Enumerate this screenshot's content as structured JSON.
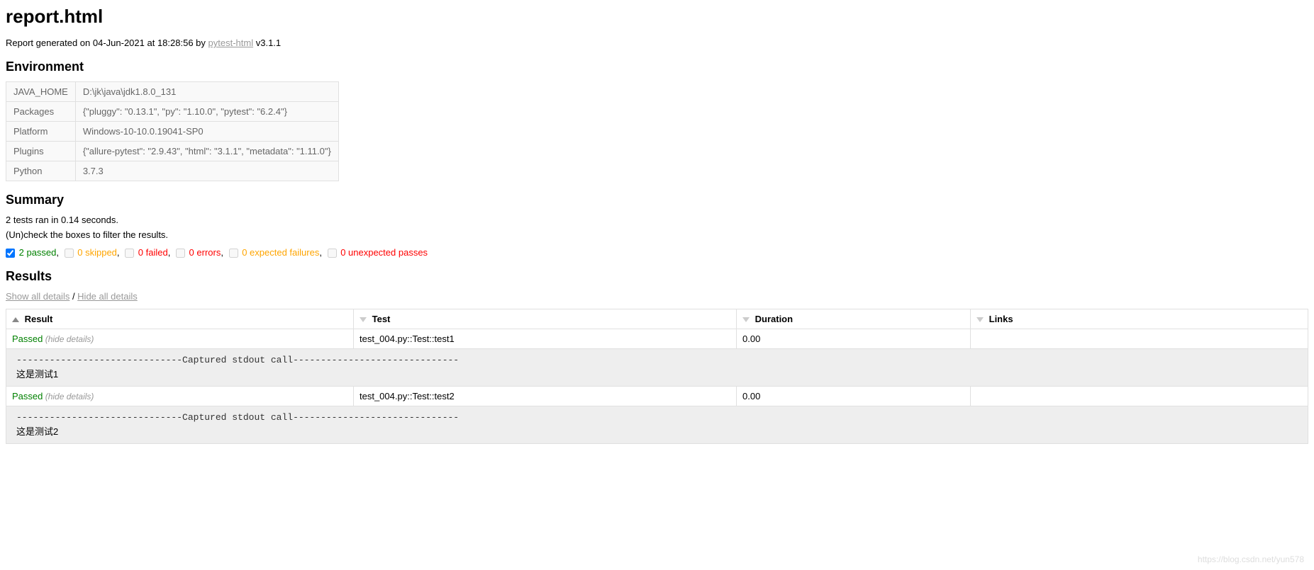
{
  "title": "report.html",
  "generated": {
    "prefix": "Report generated on ",
    "date": "04-Jun-2021",
    "at": " at ",
    "time": "18:28:56",
    "by": " by ",
    "tool_link": "pytest-html",
    "version": " v3.1.1"
  },
  "sections": {
    "environment": "Environment",
    "summary": "Summary",
    "results": "Results"
  },
  "environment": [
    {
      "key": "JAVA_HOME",
      "value": "D:\\jk\\java\\jdk1.8.0_131"
    },
    {
      "key": "Packages",
      "value": "{\"pluggy\": \"0.13.1\", \"py\": \"1.10.0\", \"pytest\": \"6.2.4\"}"
    },
    {
      "key": "Platform",
      "value": "Windows-10-10.0.19041-SP0"
    },
    {
      "key": "Plugins",
      "value": "{\"allure-pytest\": \"2.9.43\", \"html\": \"3.1.1\", \"metadata\": \"1.11.0\"}"
    },
    {
      "key": "Python",
      "value": "3.7.3"
    }
  ],
  "summary": {
    "ran": "2 tests ran in 0.14 seconds.",
    "uncheck": "(Un)check the boxes to filter the results."
  },
  "filters": {
    "passed": "2 passed",
    "skipped": "0 skipped",
    "failed": "0 failed",
    "errors": "0 errors",
    "expected": "0 expected failures",
    "unexpected": "0 unexpected passes"
  },
  "detail_links": {
    "show": "Show all details",
    "sep": " / ",
    "hide": "Hide all details"
  },
  "columns": {
    "result": "Result",
    "test": "Test",
    "duration": "Duration",
    "links": "Links"
  },
  "hide_details": "(hide details)",
  "stdout_header": "------------------------------Captured stdout call------------------------------",
  "tests": [
    {
      "result": "Passed",
      "test": "test_004.py::Test::test1",
      "duration": "0.00",
      "stdout": "这是测试1"
    },
    {
      "result": "Passed",
      "test": "test_004.py::Test::test2",
      "duration": "0.00",
      "stdout": "这是测试2"
    }
  ],
  "watermark": "https://blog.csdn.net/yun578"
}
